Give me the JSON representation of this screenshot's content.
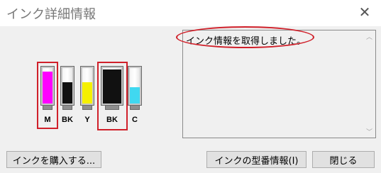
{
  "window": {
    "title": "インク詳細情報",
    "close_glyph": "✕"
  },
  "cartridges": [
    {
      "label": "M",
      "color": "#ff00ff",
      "level": 0.9,
      "highlighted": true
    },
    {
      "label": "BK",
      "color": "#111111",
      "level": 0.6,
      "highlighted": false
    },
    {
      "label": "Y",
      "color": "#f5f000",
      "level": 0.6,
      "highlighted": false
    },
    {
      "label": "BK",
      "color": "#111111",
      "level": 0.95,
      "highlighted": true
    },
    {
      "label": "C",
      "color": "#40d8f0",
      "level": 0.45,
      "highlighted": false
    }
  ],
  "message": {
    "text": "インク情報を取得しました。"
  },
  "scrollbar": {
    "up_glyph": "︿",
    "down_glyph": "﹀"
  },
  "buttons": {
    "buy_ink": "インクを購入する...",
    "ink_model_info": "インクの型番情報(I)",
    "close": "閉じる"
  },
  "colors": {
    "highlight": "#d0202a"
  }
}
